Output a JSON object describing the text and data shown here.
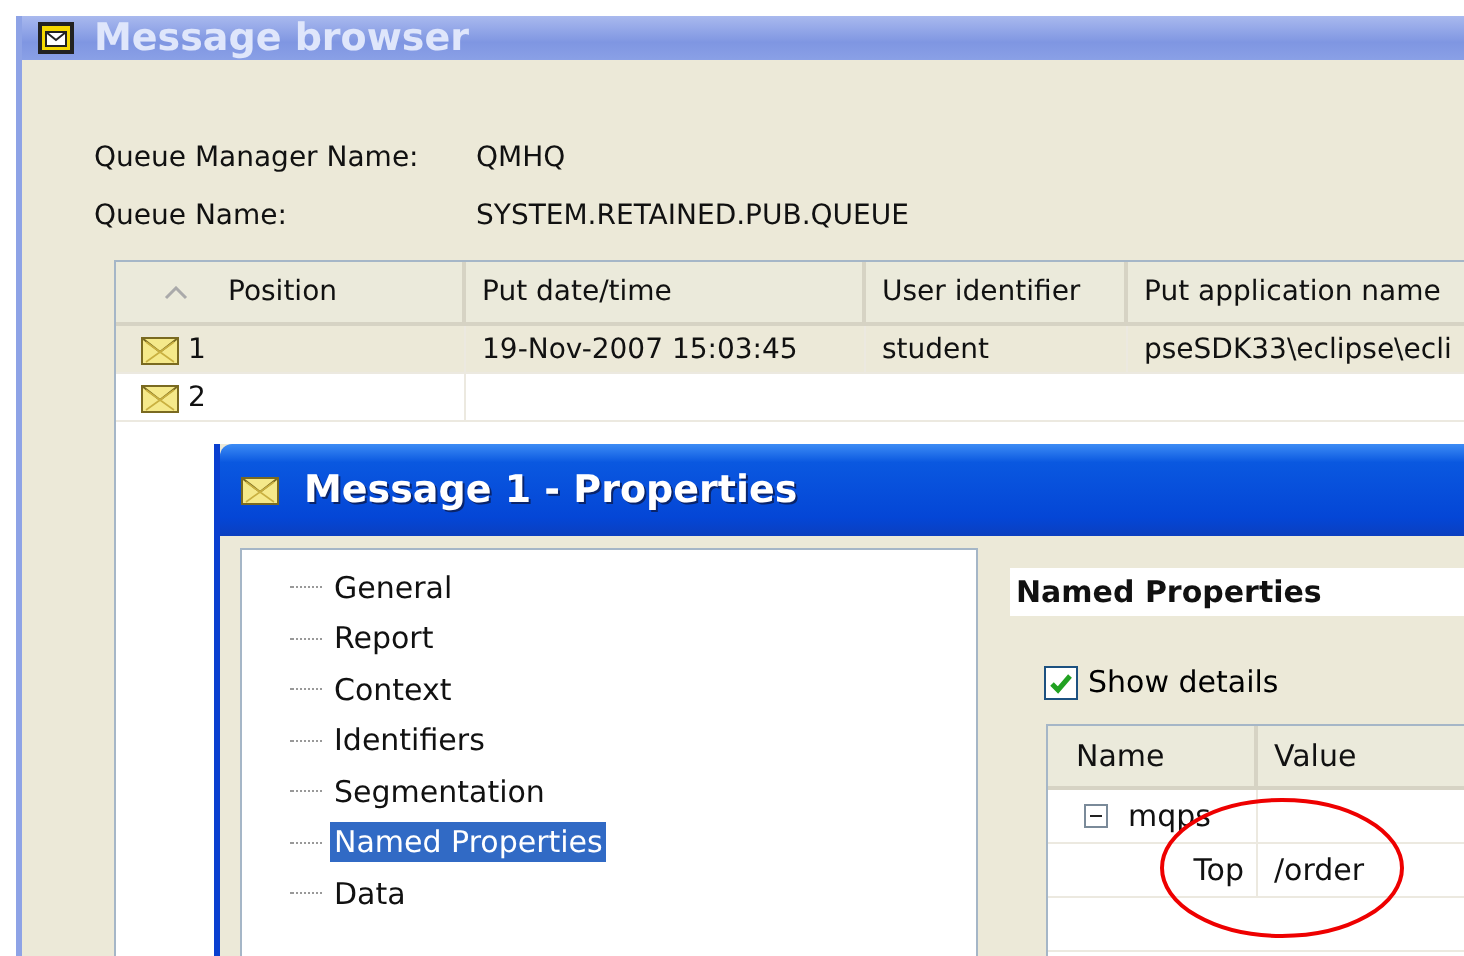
{
  "window": {
    "title": "Message browser"
  },
  "queue_manager": {
    "label": "Queue Manager Name:",
    "value": "QMHQ"
  },
  "queue": {
    "label": "Queue Name:",
    "value": "SYSTEM.RETAINED.PUB.QUEUE"
  },
  "table": {
    "columns": [
      "Position",
      "Put date/time",
      "User identifier",
      "Put application name"
    ],
    "rows": [
      {
        "cells": [
          "1",
          "19-Nov-2007 15:03:45",
          "student",
          "pseSDK33\\eclipse\\ecli"
        ]
      },
      {
        "cells": [
          "2"
        ]
      }
    ]
  },
  "dialog": {
    "title": "Message 1 - Properties",
    "tree": [
      {
        "label": "General",
        "selected": false
      },
      {
        "label": "Report",
        "selected": false
      },
      {
        "label": "Context",
        "selected": false
      },
      {
        "label": "Identifiers",
        "selected": false
      },
      {
        "label": "Segmentation",
        "selected": false
      },
      {
        "label": "Named Properties",
        "selected": true
      },
      {
        "label": "Data",
        "selected": false
      }
    ],
    "page_title": "Named Properties",
    "show_details": {
      "label": "Show details",
      "checked": true
    },
    "properties": {
      "columns": [
        "Name",
        "Value"
      ],
      "rows": [
        {
          "name": "mqps",
          "expanded": true,
          "children": [
            {
              "name": "Top",
              "value": "/order"
            }
          ]
        }
      ]
    }
  }
}
